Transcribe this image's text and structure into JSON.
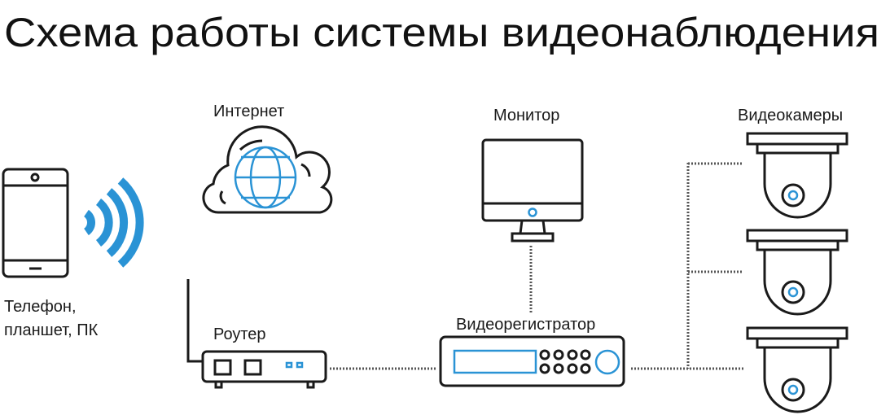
{
  "title": "Схема работы системы видеонаблюдения",
  "nodes": {
    "phone": {
      "label_line1": "Телефон,",
      "label_line2": "планшет, ПК",
      "icon": "smartphone-icon"
    },
    "wifi": {
      "icon": "wifi-signal-icon"
    },
    "internet": {
      "label": "Интернет",
      "icon": "cloud-globe-icon"
    },
    "router": {
      "label": "Роутер",
      "icon": "router-icon"
    },
    "monitor": {
      "label": "Монитор",
      "icon": "monitor-icon"
    },
    "dvr": {
      "label": "Видеорегистратор",
      "icon": "dvr-icon"
    },
    "cameras": {
      "label": "Видеокамеры",
      "icon": "dome-camera-icon",
      "count": 3
    }
  },
  "colors": {
    "accent": "#2a93d5",
    "stroke": "#1a1a1a",
    "connector": "#555555"
  }
}
